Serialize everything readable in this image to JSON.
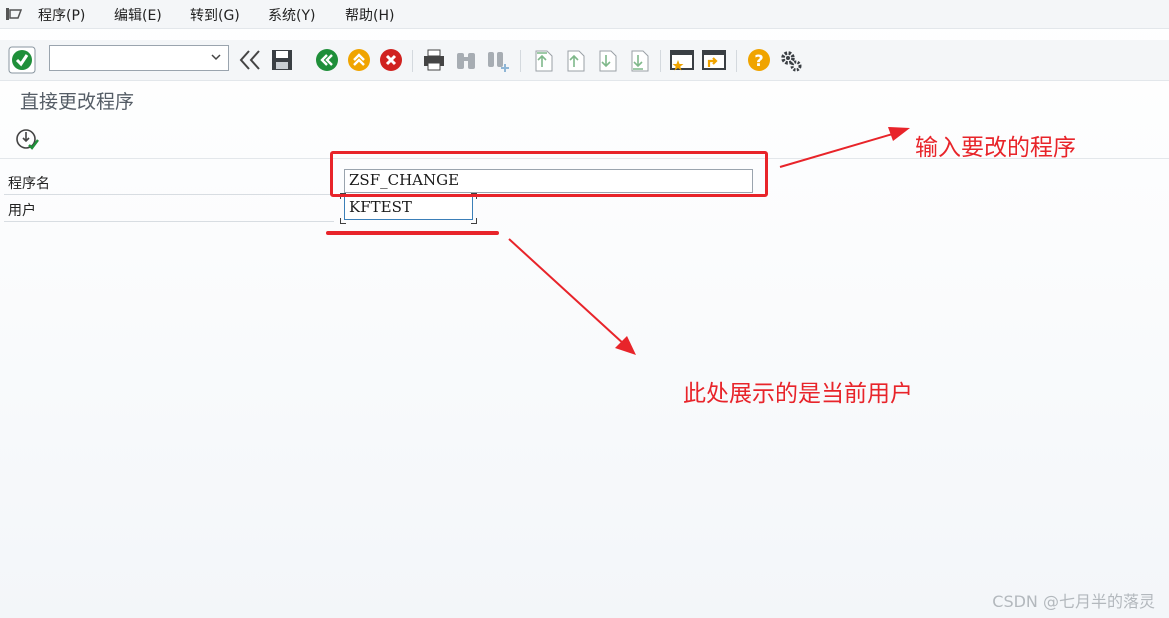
{
  "menu": {
    "items": [
      {
        "label": "程序(P)"
      },
      {
        "label": "编辑(E)"
      },
      {
        "label": "转到(G)"
      },
      {
        "label": "系统(Y)"
      },
      {
        "label": "帮助(H)"
      }
    ]
  },
  "toolbar": {
    "command_field_value": "",
    "icons": [
      "confirm-icon",
      "command-dropdown",
      "back-double-icon",
      "save-icon",
      "back-icon",
      "exit-icon",
      "cancel-icon",
      "print-icon",
      "find-icon",
      "find-next-icon",
      "first-page-icon",
      "previous-page-icon",
      "next-page-icon",
      "last-page-icon",
      "create-session-icon",
      "generate-shortcut-icon",
      "help-icon",
      "settings-icon"
    ]
  },
  "screen": {
    "title": "直接更改程序",
    "execute_icon": "execute-icon"
  },
  "form": {
    "program_label": "程序名",
    "program_value": "ZSF_CHANGE",
    "user_label": "用户",
    "user_value": "KFTEST"
  },
  "annotations": {
    "input_note": "输入要改的程序",
    "user_note": "此处展示的是当前用户",
    "color": "#e8242a"
  },
  "watermark": "CSDN @七月半的落灵"
}
